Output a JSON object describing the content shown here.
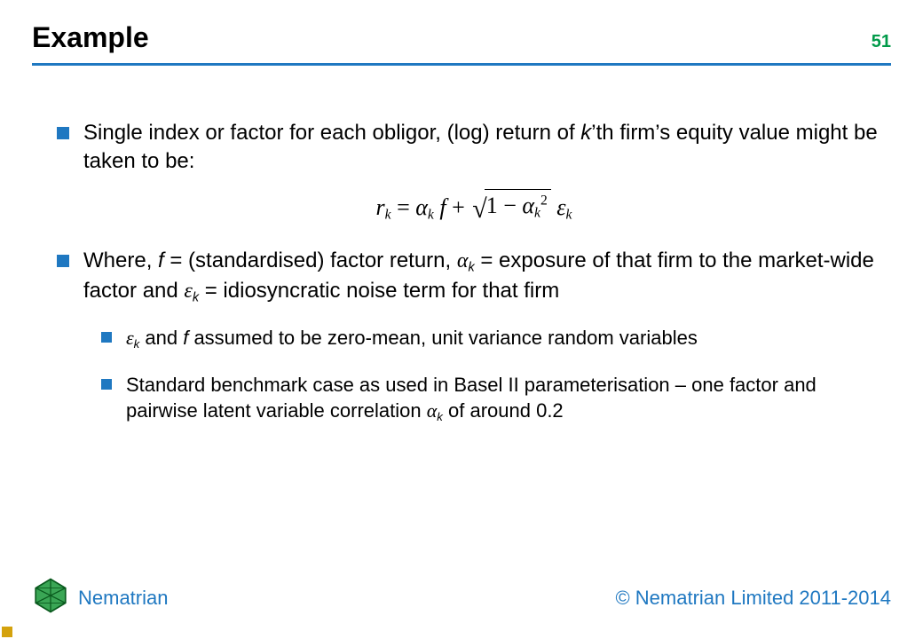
{
  "header": {
    "title": "Example",
    "page_number": "51"
  },
  "equation": {
    "lhs_prefix": "r",
    "lhs_sub": "k",
    "eq": " = ",
    "term1_alpha": "α",
    "term1_sub": "k",
    "term1_f": " f ",
    "plus": " + ",
    "sqrt_inner_one": "1",
    "sqrt_minus": " − ",
    "sqrt_alpha": "α",
    "sqrt_sub": "k",
    "sqrt_sup": "2",
    "tail_space": " ",
    "tail_eps": "ε",
    "tail_sub": "k"
  },
  "bullets": {
    "b1_pre": "Single index or factor for each obligor, (log) return of ",
    "b1_k": "k",
    "b1_post": "’th firm’s equity value might be taken to be:",
    "b2_pre": "Where, ",
    "b2_f": "f",
    "b2_a": " = (standardised) factor return, ",
    "b2_alpha": "α",
    "b2_alpha_sub": "k",
    "b2_mid": " = exposure of that firm to the market-wide factor and ",
    "b2_eps": "ε",
    "b2_eps_sub": "k",
    "b2_post": " = idiosyncratic noise term for that firm",
    "s1_eps": "ε",
    "s1_eps_sub": "k",
    "s1_mid": " and ",
    "s1_f": "f",
    "s1_post": " assumed to be zero-mean, unit variance random variables",
    "s2_pre": "Standard benchmark case as used in Basel II parameterisation – one factor and pairwise latent variable correlation ",
    "s2_alpha": "α",
    "s2_alpha_sub": "k",
    "s2_post": " of around 0.2"
  },
  "footer": {
    "brand": "Nematrian",
    "copyright": "© Nematrian Limited 2011-2014"
  }
}
